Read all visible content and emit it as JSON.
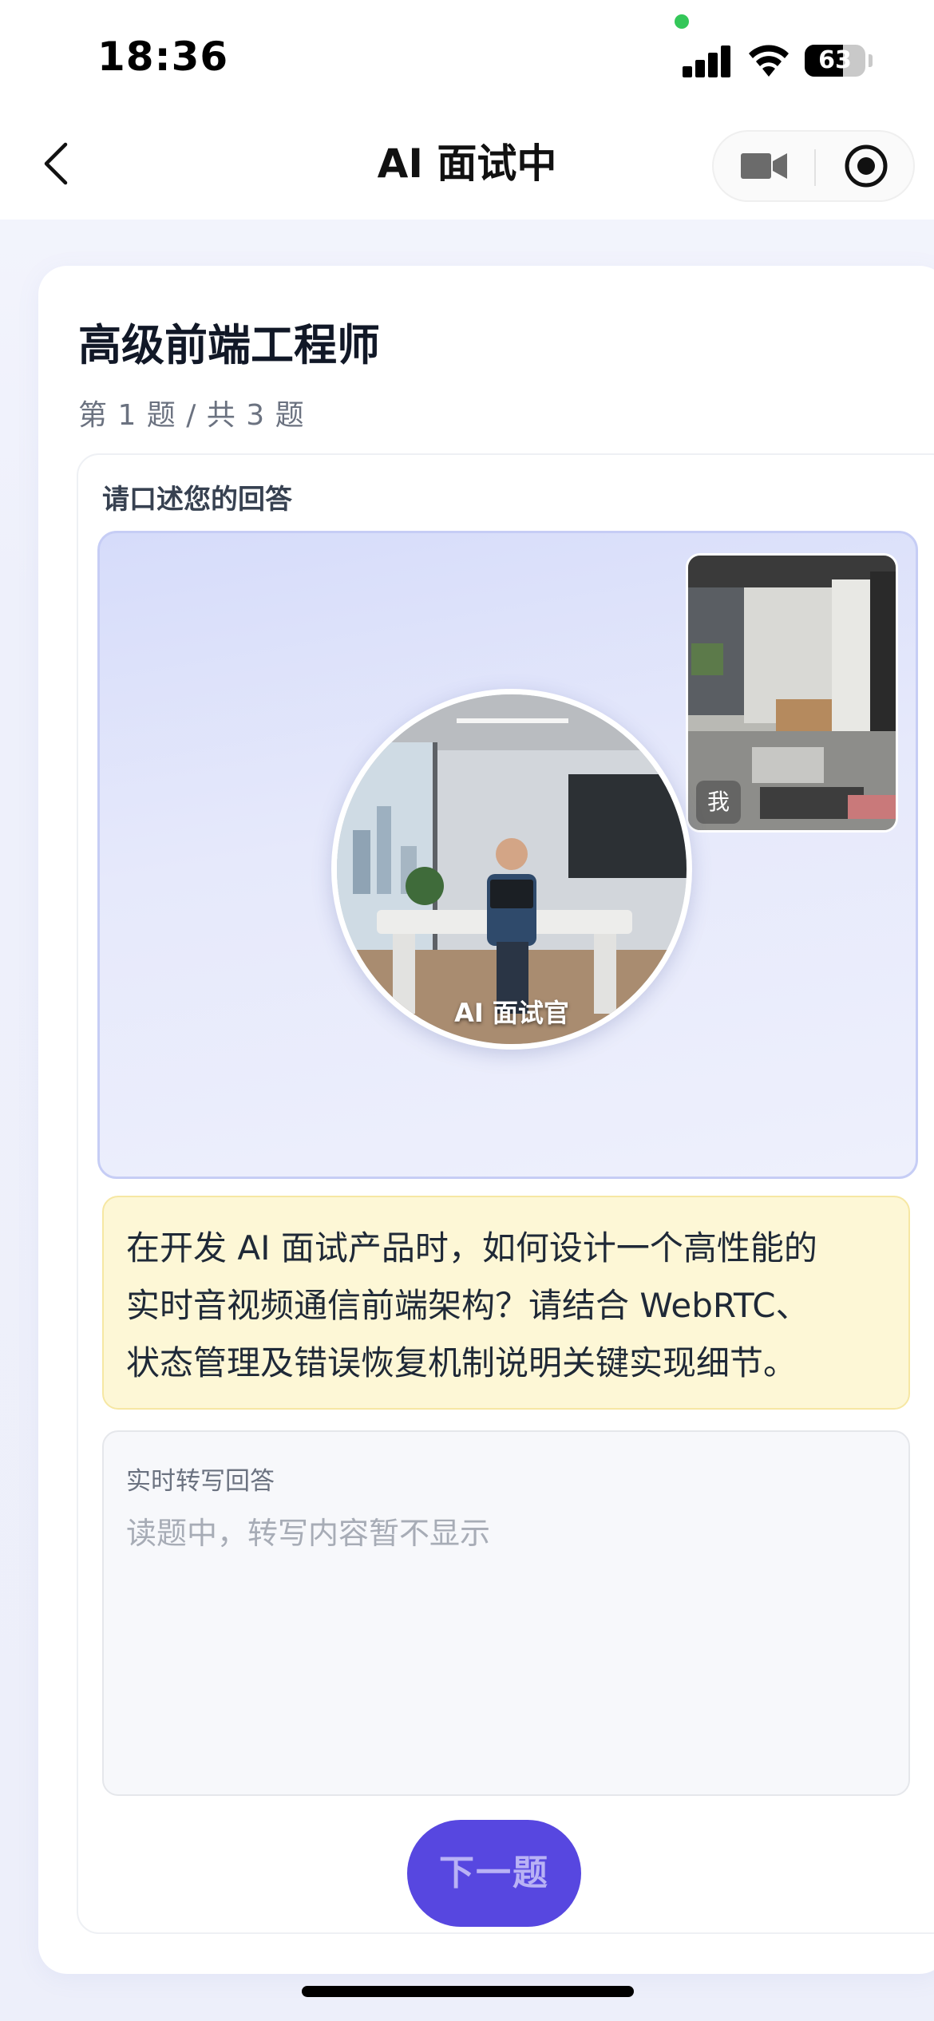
{
  "status_bar": {
    "time": "18:36",
    "battery_level": "63",
    "icons": [
      "signal-icon",
      "wifi-icon",
      "battery-icon"
    ]
  },
  "nav": {
    "title": "AI 面试中",
    "icons": [
      "back-icon",
      "video-camera-icon",
      "record-icon"
    ]
  },
  "interview": {
    "job_title": "高级前端工程师",
    "progress": "第 1 题 / 共 3 题",
    "answer_label": "请口述您的回答",
    "self_label": "我",
    "interviewer_label": "AI 面试官",
    "question_lines": [
      "在开发 AI 面试产品时，如何设计一个高性能的",
      "实时音视频通信前端架构？请结合 WebRTC、",
      "状态管理及错误恢复机制说明关键实现细节。"
    ],
    "transcript_label": "实时转写回答",
    "transcript_placeholder": "读题中，转写内容暂不显示",
    "next_button": "下一题"
  },
  "colors": {
    "accent": "#5747e0",
    "question_bg": "#fdf7d6",
    "video_border": "#c6cdf5",
    "status_dot": "#34c759"
  }
}
